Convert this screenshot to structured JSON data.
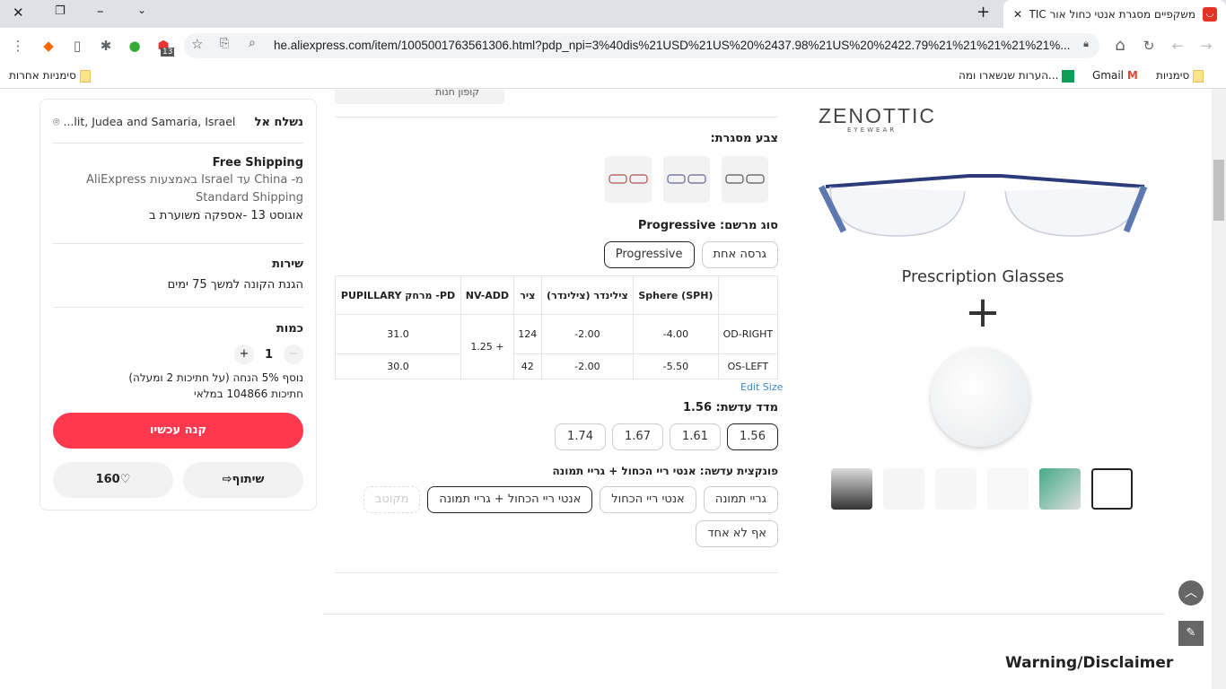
{
  "browser": {
    "tab_title": "משקפיים מסגרת אנטי כחול אור ZENOTTIC",
    "url": "he.aliexpress.com/item/1005001763561306.html?pdp_npi=3%40dis%21USD%21US%20%2437.98%21US%20%2422.79%21%21%21%21%21%...",
    "badge_count": "13",
    "bookmarks": [
      "סימניות",
      "Gmail",
      "הערות שנשארו ומה..."
    ],
    "other_bookmarks": "סימניות אחרות"
  },
  "shipping": {
    "ship_to_label": "נשלח אל",
    "location": "...lit, Judea and Samaria, Israel",
    "free_shipping": "Free Shipping",
    "route": "מ- China עד Israel באמצעות AliExpress Standard Shipping",
    "delivery": "אוגוסט 13 -אספקה משוערת ב"
  },
  "service": {
    "title": "שירות",
    "text": "הגנת הקונה למשך 75 ימים"
  },
  "quantity": {
    "title": "כמות",
    "value": "1",
    "discount": "נוסף 5% הנחה (על חתיכות 2 ומעלה)",
    "stock": "חתיכות 104866 במלאי"
  },
  "actions": {
    "buy_now": "קנה עכשיו",
    "share": "שיתוף",
    "wishlist": "160"
  },
  "product": {
    "coupon": "קופון חנות",
    "frame_color_label": "צבע מסגרת:",
    "prescription_label": "סוג מרשם: Progressive",
    "prescription_options": [
      "גרסה אחת",
      "Progressive"
    ],
    "table": {
      "headers": [
        "",
        "Sphere (SPH)",
        "צילינדר (צילינדר)",
        "ציר",
        "NV-ADD",
        "PD- מרחק PUPILLARY"
      ],
      "rows": [
        [
          "OD-RIGHT",
          "-4.00",
          "-2.00",
          "124",
          "+ 1.25",
          "31.0"
        ],
        [
          "OS-LEFT",
          "-5.50",
          "-2.00",
          "42",
          "",
          "30.0"
        ]
      ],
      "edit": "Edit Size"
    },
    "index_label": "מדד עדשת: 1.56",
    "index_options": [
      "1.56",
      "1.61",
      "1.67",
      "1.74"
    ],
    "function_label": "פונקצית עדשה: אנטי ריי הכחול + גריי תמונה",
    "function_options": [
      "גריי תמונה",
      "אנטי ריי הכחול",
      "אנטי ריי הכחול + גריי תמונה",
      "מקוטב",
      "אף לא אחד"
    ]
  },
  "gallery": {
    "brand": "ZENOTTIC",
    "brand_sub": "EYEWEAR",
    "caption": "Prescription Glasses",
    "plus": "+"
  },
  "disclaimer": "Warning/Disclaimer"
}
